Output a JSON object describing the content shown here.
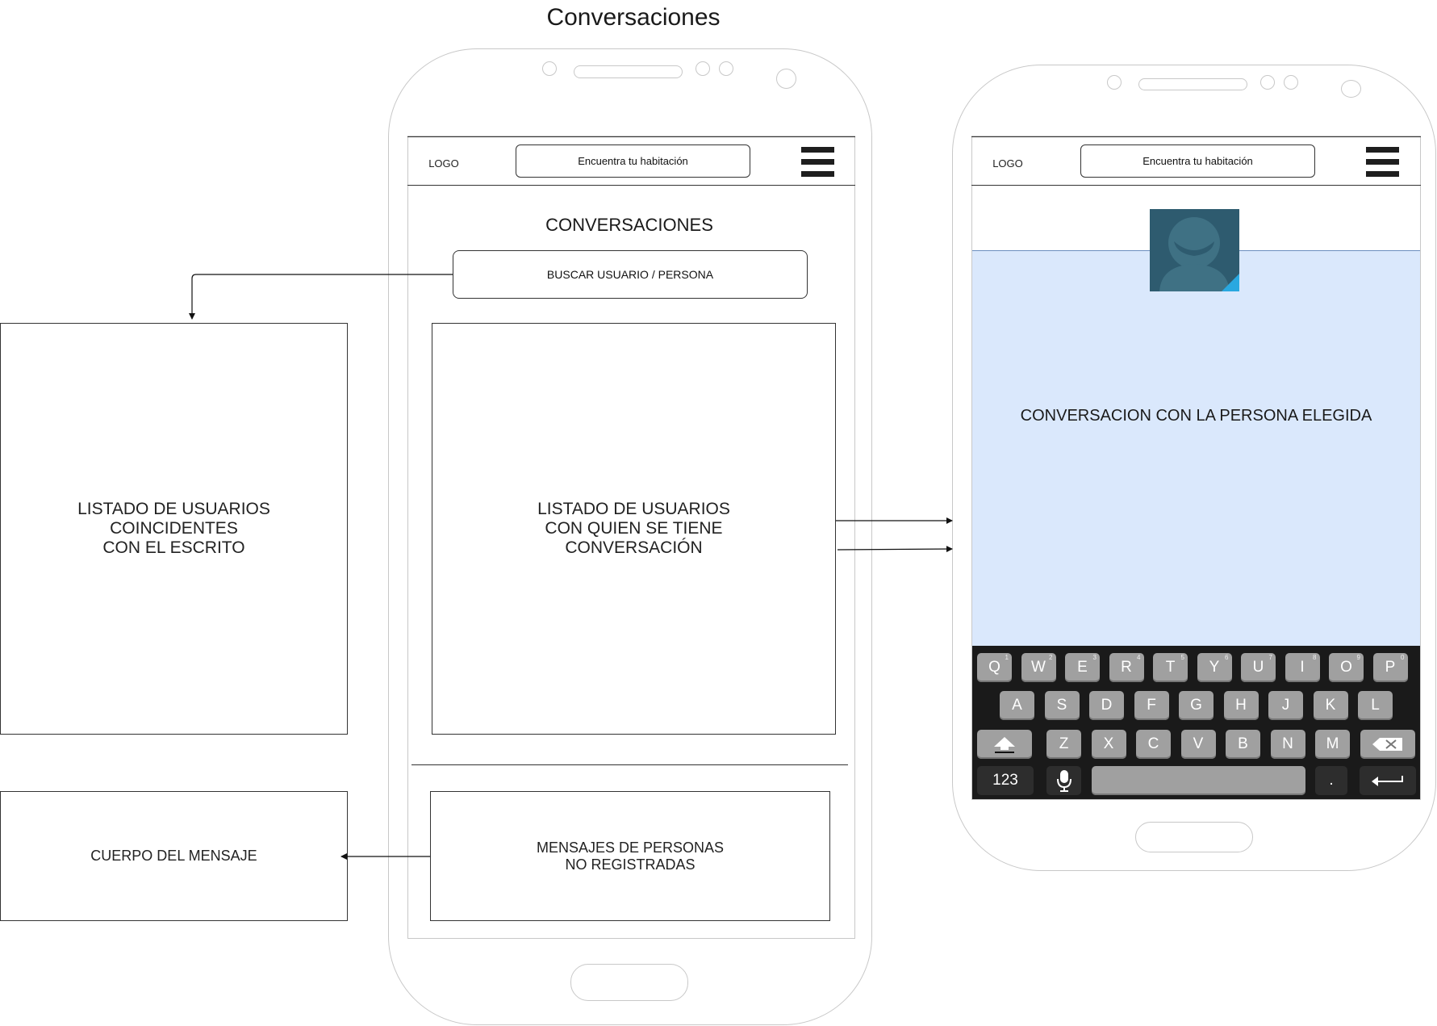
{
  "page_title": "Conversaciones",
  "left_phone": {
    "header": {
      "logo": "LOGO",
      "search_button": "Encuentra tu habitación"
    },
    "screen_title": "CONVERSACIONES",
    "search_field": "BUSCAR USUARIO / PERSONA",
    "conversation_list": "LISTADO DE USUARIOS\nCON QUIEN SE TIENE\nCONVERSACIÓN",
    "unregistered_messages": "MENSAJES DE PERSONAS\nNO REGISTRADAS"
  },
  "side_boxes": {
    "matching_users": "LISTADO DE USUARIOS\nCOINCIDENTES\nCON EL ESCRITO",
    "message_body": "CUERPO DEL MENSAJE"
  },
  "right_phone": {
    "header": {
      "logo": "LOGO",
      "search_button": "Encuentra tu habitación"
    },
    "conversation": "CONVERSACION CON LA PERSONA ELEGIDA",
    "keyboard": {
      "row1": [
        {
          "k": "Q",
          "n": "1"
        },
        {
          "k": "W",
          "n": "2"
        },
        {
          "k": "E",
          "n": "3"
        },
        {
          "k": "R",
          "n": "4"
        },
        {
          "k": "T",
          "n": "5"
        },
        {
          "k": "Y",
          "n": "6"
        },
        {
          "k": "U",
          "n": "7"
        },
        {
          "k": "I",
          "n": "8"
        },
        {
          "k": "O",
          "n": "9"
        },
        {
          "k": "P",
          "n": "0"
        }
      ],
      "row2": [
        "A",
        "S",
        "D",
        "F",
        "G",
        "H",
        "J",
        "K",
        "L"
      ],
      "row3": [
        "Z",
        "X",
        "C",
        "V",
        "B",
        "N",
        "M"
      ],
      "numbers_key": "123",
      "period_key": "."
    }
  },
  "colors": {
    "conversation_fill": "#dae8fc",
    "conversation_border": "#6c8ebf",
    "avatar_bg": "#2e5b6f",
    "key_fill": "#a0a0a0",
    "keyboard_bg": "#1a1a1a"
  }
}
